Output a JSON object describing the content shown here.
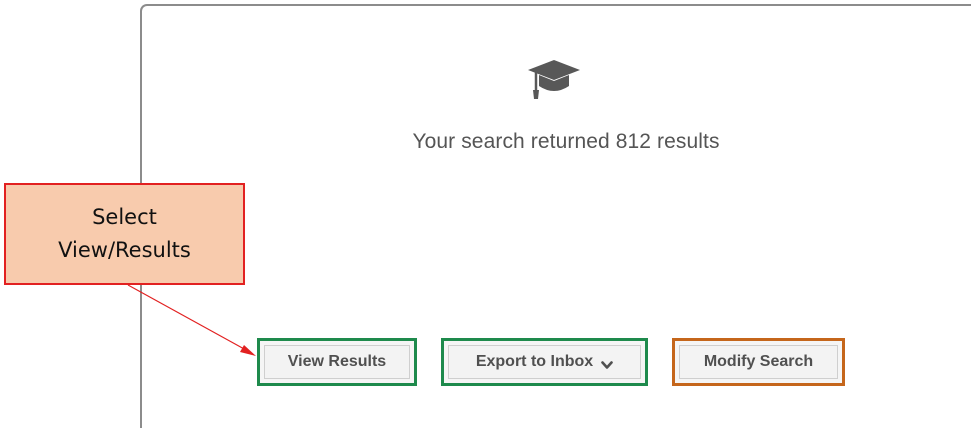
{
  "search_panel": {
    "icon": "graduation-cap-icon",
    "result_message": "Your search returned 812 results"
  },
  "actions": {
    "view_results_label": "View Results",
    "export_label": "Export to Inbox",
    "export_icon": "chevron-down-icon",
    "modify_label": "Modify Search"
  },
  "annotation": {
    "callout_line1": "Select",
    "callout_line2": "View/Results",
    "arrow_target": "view-results-button"
  },
  "colors": {
    "primary_button_border": "#1e8a4c",
    "modify_button_border": "#c5661b",
    "callout_fill": "#f8cbad",
    "callout_border": "#e22121",
    "arrow": "#e22121"
  }
}
